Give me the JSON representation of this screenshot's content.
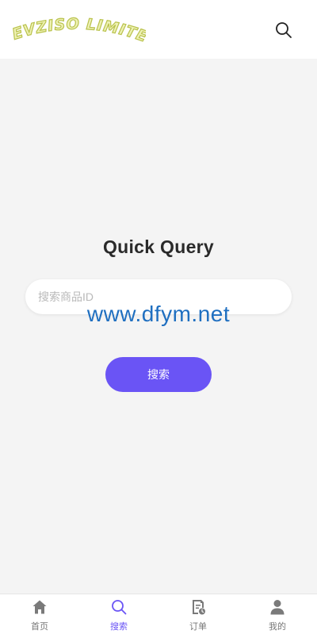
{
  "header": {
    "logo_text": "EVZISO LIMITED",
    "search_icon": "search-icon"
  },
  "main": {
    "title": "Quick Query",
    "search_placeholder": "搜索商品ID",
    "search_value": "",
    "submit_label": "搜索",
    "watermark": "www.dfym.net"
  },
  "tabbar": {
    "items": [
      {
        "label": "首页",
        "icon": "home-icon",
        "active": false
      },
      {
        "label": "搜索",
        "icon": "search-icon",
        "active": true
      },
      {
        "label": "订单",
        "icon": "order-icon",
        "active": false
      },
      {
        "label": "我的",
        "icon": "user-icon",
        "active": false
      }
    ]
  },
  "colors": {
    "accent": "#6a54f5",
    "logo": "#d9e27a",
    "background": "#f4f4f4",
    "watermark": "#1f6fc0"
  }
}
